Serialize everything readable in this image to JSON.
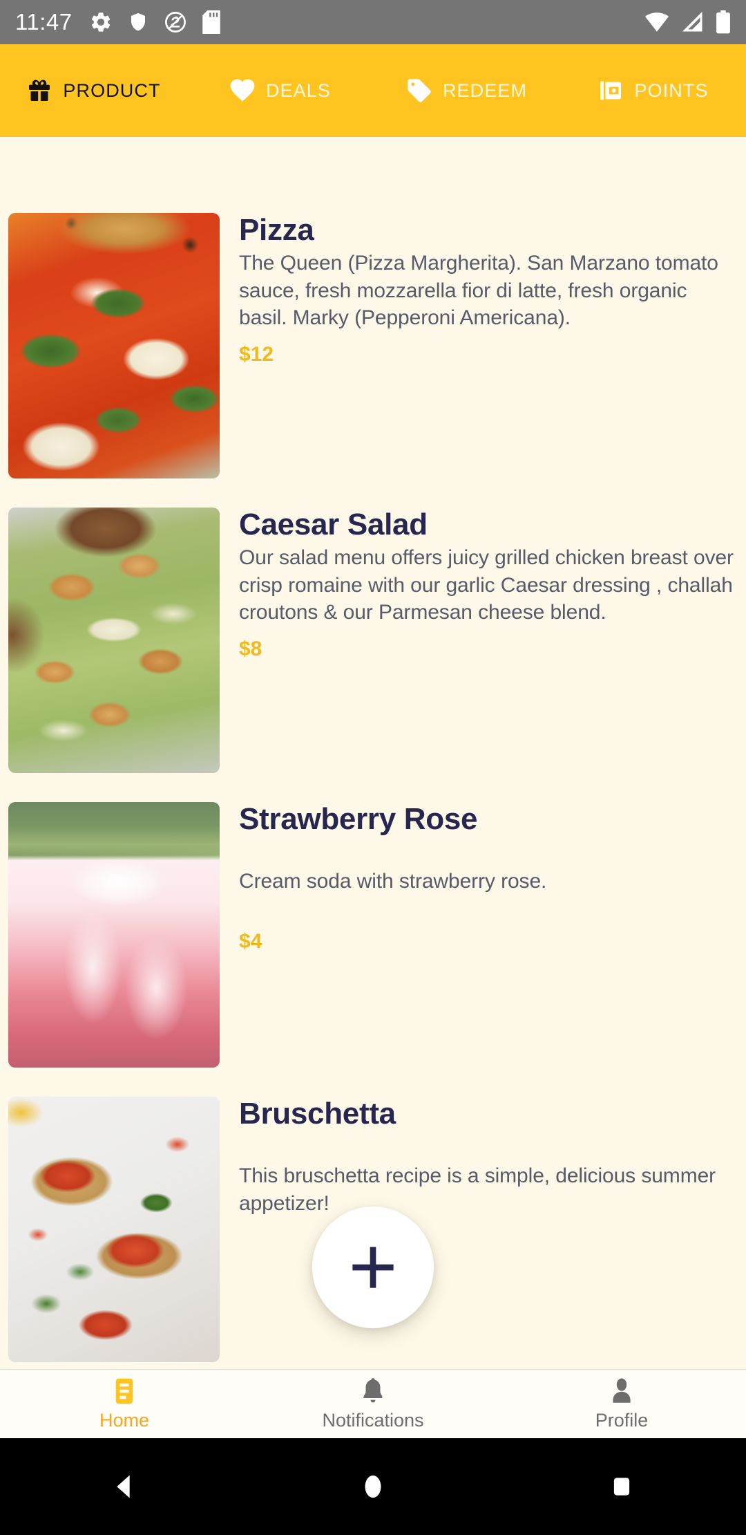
{
  "status_bar": {
    "time": "11:47",
    "left_icons": [
      "gear-icon",
      "shield-icon",
      "android-q-icon",
      "sd-card-icon"
    ],
    "right_icons": [
      "wifi-icon",
      "cell-signal-icon",
      "battery-icon"
    ],
    "background_color": "#757575"
  },
  "top_tabs": {
    "accent_color": "#FFC420",
    "active_index": 0,
    "items": [
      {
        "label": "PRODUCT",
        "icon": "gift-icon",
        "active": true
      },
      {
        "label": "DEALS",
        "icon": "heart-icon",
        "active": false
      },
      {
        "label": "REDEEM",
        "icon": "tag-icon",
        "active": false
      },
      {
        "label": "POINTS",
        "icon": "wallet-icon",
        "active": false
      }
    ]
  },
  "products": [
    {
      "name": "Pizza",
      "description": "The Queen (Pizza Margherita). San Marzano tomato sauce, fresh mozzarella fior di latte, fresh organic basil. Marky (Pepperoni Americana).",
      "price": "$12",
      "image": "pizza-margherita-photo"
    },
    {
      "name": "Caesar Salad",
      "description": "Our salad menu offers juicy grilled chicken breast over crisp romaine with our garlic Caesar dressing , challah croutons & our Parmesan cheese blend.",
      "price": "$8",
      "image": "caesar-salad-photo"
    },
    {
      "name": "Strawberry Rose",
      "description": "Cream soda with strawberry rose.",
      "price": "$4",
      "image": "strawberry-rose-drink-photo"
    },
    {
      "name": "Bruschetta",
      "description": "This bruschetta recipe is a simple, delicious summer appetizer!",
      "price": "",
      "image": "bruschetta-photo"
    }
  ],
  "fab": {
    "icon": "plus-icon",
    "label": "Add"
  },
  "bottom_nav": {
    "active_index": 0,
    "active_color": "#F5A623",
    "inactive_color": "#6d6d6d",
    "items": [
      {
        "label": "Home",
        "icon": "list-icon",
        "active": true
      },
      {
        "label": "Notifications",
        "icon": "bell-icon",
        "active": false
      },
      {
        "label": "Profile",
        "icon": "person-icon",
        "active": false
      }
    ]
  },
  "android_nav": {
    "buttons": [
      {
        "name": "back",
        "icon": "triangle-left-icon"
      },
      {
        "name": "home",
        "icon": "circle-icon"
      },
      {
        "name": "recents",
        "icon": "square-icon"
      }
    ]
  },
  "theme": {
    "page_background": "#FDF8E8",
    "title_color": "#26264F",
    "body_text_color": "#575A69",
    "price_color": "#F2B91C"
  }
}
